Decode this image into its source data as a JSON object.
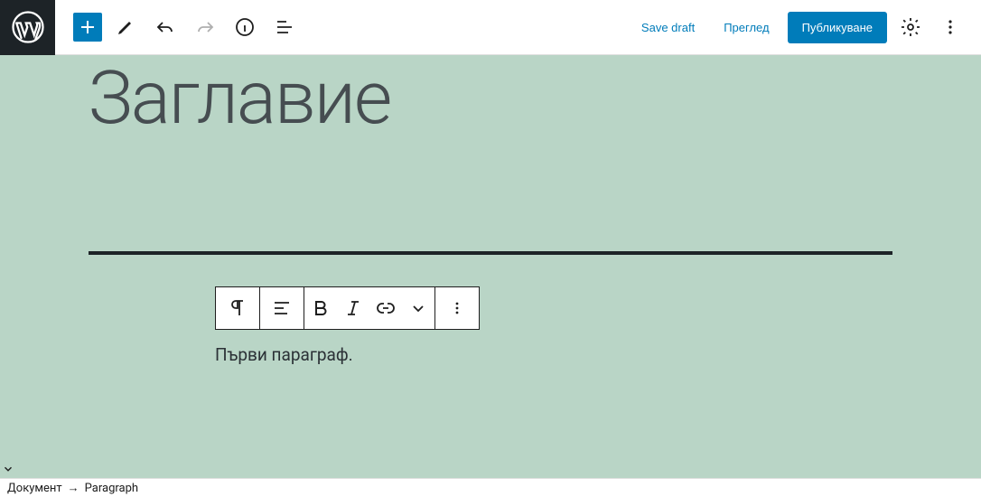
{
  "topbar": {
    "save_draft": "Save draft",
    "preview": "Преглед",
    "publish": "Публикуване"
  },
  "editor": {
    "title": "Заглавие",
    "paragraph": "Първи параграф."
  },
  "footer": {
    "root": "Документ",
    "current": "Paragraph"
  }
}
